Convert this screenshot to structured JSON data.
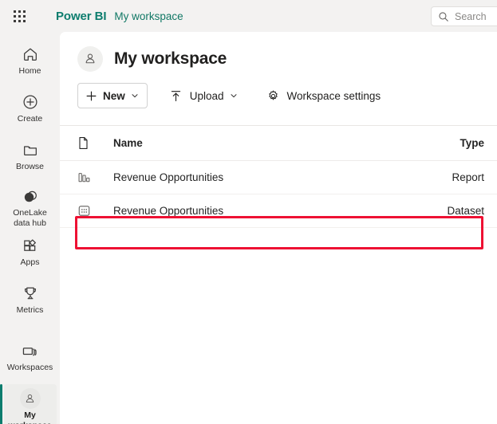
{
  "topbar": {
    "waffle_icon": "waffle-grid-icon",
    "brand": "Power BI",
    "breadcrumb": "My workspace",
    "search": {
      "icon": "search-icon",
      "placeholder": "Search",
      "value": ""
    }
  },
  "sidebar": {
    "items": [
      {
        "label": "Home",
        "icon": "home-icon",
        "selected": false
      },
      {
        "label": "Create",
        "icon": "plus-circle-icon",
        "selected": false
      },
      {
        "label": "Browse",
        "icon": "folder-icon",
        "selected": false
      },
      {
        "label": "OneLake data hub",
        "icon": "onelake-icon",
        "selected": false
      },
      {
        "label": "Apps",
        "icon": "apps-grid-icon",
        "selected": false
      },
      {
        "label": "Metrics",
        "icon": "trophy-icon",
        "selected": false
      },
      {
        "label": "Workspaces",
        "icon": "workspaces-stack-icon",
        "selected": false
      },
      {
        "label": "My workspace",
        "icon": "person-avatar-icon",
        "selected": true
      }
    ]
  },
  "workspace": {
    "avatar_icon": "person-avatar-icon",
    "title": "My workspace"
  },
  "toolbar": {
    "new_label": "New",
    "new_icon": "plus-icon",
    "new_chevron": "chevron-down-icon",
    "upload_label": "Upload",
    "upload_icon": "upload-arrow-icon",
    "upload_chevron": "chevron-down-icon",
    "settings_label": "Workspace settings",
    "settings_icon": "gear-icon"
  },
  "table": {
    "columns": {
      "icon": "file-icon",
      "name": "Name",
      "type": "Type"
    },
    "rows": [
      {
        "icon": "report-bars-icon",
        "name": "Revenue Opportunities",
        "type": "Report",
        "highlighted": true
      },
      {
        "icon": "dataset-dots-icon",
        "name": "Revenue Opportunities",
        "type": "Dataset",
        "highlighted": false
      }
    ]
  },
  "colors": {
    "brand": "#0d7d6e",
    "highlight": "#ee1133",
    "nav_background": "#f3f2f1",
    "content_background": "#ffffff",
    "text_primary": "#242424"
  }
}
